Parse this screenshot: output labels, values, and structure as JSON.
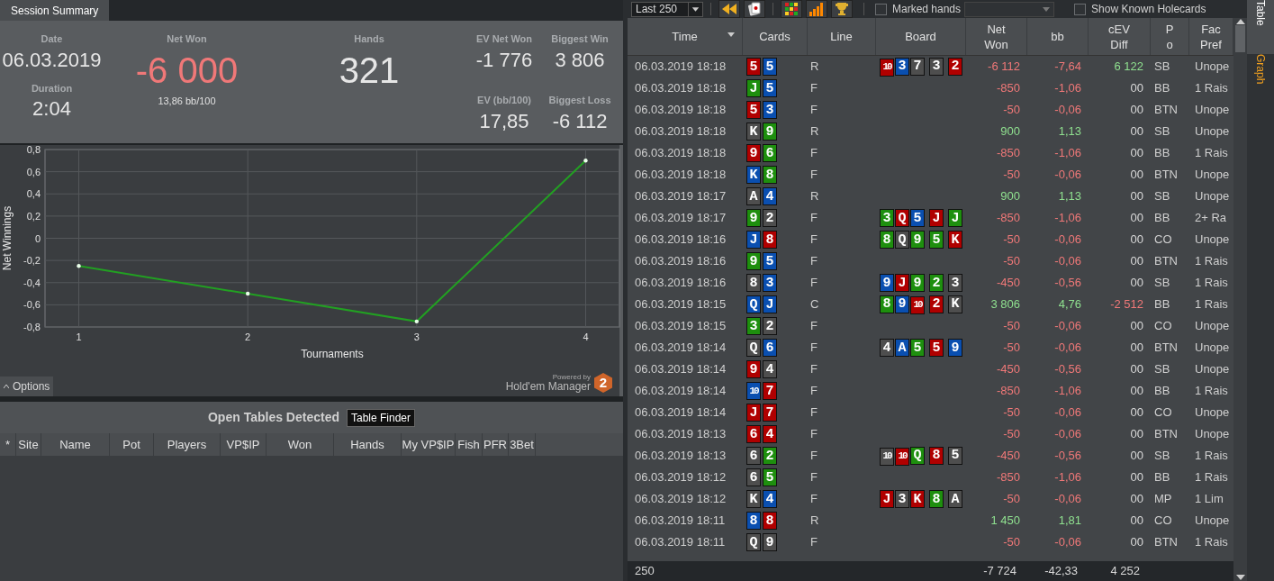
{
  "session_tab": {
    "label": "Session Summary",
    "selected": true
  },
  "summary": {
    "date_label": "Date",
    "date": "06.03.2019",
    "duration_label": "Duration",
    "duration": "2:04",
    "net_won_label": "Net Won",
    "net_won": "-6 000",
    "net_won_negative": true,
    "bb100": "13,86 bb/100",
    "hands_label": "Hands",
    "hands": "321",
    "ev_net_won_label": "EV Net Won",
    "ev_net_won": "-1 776",
    "biggest_win_label": "Biggest Win",
    "biggest_win": "3 806",
    "ev_bb100_label": "EV (bb/100)",
    "ev_bb100": "17,85",
    "biggest_loss_label": "Biggest Loss",
    "biggest_loss": "-6 112"
  },
  "chart": {
    "chart_data": {
      "type": "line",
      "xlabel": "Tournaments",
      "ylabel": "Net Winnings",
      "x": [
        1,
        2,
        3,
        4
      ],
      "grid": true,
      "series": [
        {
          "color": "#22a022",
          "values": [
            -0.25,
            -0.5,
            -0.75,
            0.7
          ]
        }
      ],
      "xlim": [
        0.8,
        4.2
      ],
      "ylim": [
        -0.8,
        0.8
      ],
      "xticks": [
        1,
        2,
        3,
        4
      ],
      "yticks": [
        {
          "value": 0.8,
          "label": "0,8"
        },
        {
          "value": 0.6,
          "label": "0,6"
        },
        {
          "value": 0.4,
          "label": "0,4"
        },
        {
          "value": 0.2,
          "label": "0,2"
        },
        {
          "value": 0,
          "label": "0"
        },
        {
          "value": -0.2,
          "label": "-0,2"
        },
        {
          "value": -0.4,
          "label": "-0,4"
        },
        {
          "value": -0.6,
          "label": "-0,6"
        },
        {
          "value": -0.8,
          "label": "-0,8"
        }
      ]
    },
    "options_label": "Options",
    "powered_by": "Powered by",
    "brand": "Hold'em Manager",
    "brand_badge": "2"
  },
  "open_tables": {
    "title": "Open Tables Detected",
    "finder_button": "Table Finder",
    "columns": [
      "*",
      "Site",
      "Name",
      "Pot",
      "Players",
      "VP$IP",
      "Won",
      "Hands",
      "My VP$IP",
      "Fish",
      "PFR",
      "3Bet"
    ]
  },
  "toolbar": {
    "range": "Last 250",
    "marked_hands": {
      "label": "Marked hands",
      "checked": false
    },
    "show_holecards": {
      "label": "Show Known Holecards",
      "checked": false
    }
  },
  "hands_table": {
    "columns": [
      {
        "lines": [
          "Time"
        ],
        "sortable": true
      },
      {
        "lines": [
          "Cards"
        ],
        "sortable": false
      },
      {
        "lines": [
          "Line"
        ],
        "sortable": false
      },
      {
        "lines": [
          "Board"
        ],
        "sortable": false
      },
      {
        "lines": [
          "Net",
          "Won"
        ],
        "sortable": false
      },
      {
        "lines": [
          "bb"
        ],
        "sortable": false
      },
      {
        "lines": [
          "cEV",
          "Diff"
        ],
        "sortable": false
      },
      {
        "lines": [
          "P",
          "o"
        ],
        "sortable": false
      },
      {
        "lines": [
          "Fac",
          "Pref"
        ],
        "sortable": false
      }
    ],
    "rows": [
      {
        "time": "06.03.2019 18:18",
        "cards": [
          {
            "rank": "5",
            "color": "#b00000"
          },
          {
            "rank": "5",
            "color": "#0a4fb0"
          }
        ],
        "line": "R",
        "board": [
          {
            "rank": "10",
            "color": "#b00000"
          },
          {
            "rank": "3",
            "color": "#0a4fb0"
          },
          {
            "rank": "7",
            "color": "#4e4e4e"
          },
          {
            "rank": "3",
            "color": "#4e4e4e"
          },
          {
            "rank": "2",
            "color": "#b00000"
          }
        ],
        "net_won": "-6 112",
        "bb": "-7,64",
        "cev_diff": "6 122",
        "position": "SB",
        "facing": "Unope",
        "negative": true,
        "cev_gain": true,
        "cev_loss": false
      },
      {
        "time": "06.03.2019 18:18",
        "cards": [
          {
            "rank": "J",
            "color": "#1e8f0e"
          },
          {
            "rank": "5",
            "color": "#0a4fb0"
          }
        ],
        "line": "F",
        "net_won": "-850",
        "bb": "-1,06",
        "cev_diff": "00",
        "position": "BB",
        "facing": "1 Rais",
        "negative": true,
        "cev_gain": false,
        "cev_loss": false
      },
      {
        "time": "06.03.2019 18:18",
        "cards": [
          {
            "rank": "5",
            "color": "#b00000"
          },
          {
            "rank": "3",
            "color": "#0a4fb0"
          }
        ],
        "line": "F",
        "net_won": "-50",
        "bb": "-0,06",
        "cev_diff": "00",
        "position": "BTN",
        "facing": "Unope",
        "negative": true,
        "cev_gain": false,
        "cev_loss": false
      },
      {
        "time": "06.03.2019 18:18",
        "cards": [
          {
            "rank": "K",
            "color": "#4e4e4e"
          },
          {
            "rank": "9",
            "color": "#1e8f0e"
          }
        ],
        "line": "R",
        "net_won": "900",
        "bb": "1,13",
        "cev_diff": "00",
        "position": "SB",
        "facing": "Unope",
        "negative": false,
        "cev_gain": false,
        "cev_loss": false
      },
      {
        "time": "06.03.2019 18:18",
        "cards": [
          {
            "rank": "9",
            "color": "#b00000"
          },
          {
            "rank": "6",
            "color": "#1e8f0e"
          }
        ],
        "line": "F",
        "net_won": "-850",
        "bb": "-1,06",
        "cev_diff": "00",
        "position": "BB",
        "facing": "1 Rais",
        "negative": true,
        "cev_gain": false,
        "cev_loss": false
      },
      {
        "time": "06.03.2019 18:18",
        "cards": [
          {
            "rank": "K",
            "color": "#0a4fb0"
          },
          {
            "rank": "8",
            "color": "#1e8f0e"
          }
        ],
        "line": "F",
        "net_won": "-50",
        "bb": "-0,06",
        "cev_diff": "00",
        "position": "BTN",
        "facing": "Unope",
        "negative": true,
        "cev_gain": false,
        "cev_loss": false
      },
      {
        "time": "06.03.2019 18:17",
        "cards": [
          {
            "rank": "A",
            "color": "#4e4e4e"
          },
          {
            "rank": "4",
            "color": "#0a4fb0"
          }
        ],
        "line": "R",
        "net_won": "900",
        "bb": "1,13",
        "cev_diff": "00",
        "position": "SB",
        "facing": "Unope",
        "negative": false,
        "cev_gain": false,
        "cev_loss": false
      },
      {
        "time": "06.03.2019 18:17",
        "cards": [
          {
            "rank": "9",
            "color": "#1e8f0e"
          },
          {
            "rank": "2",
            "color": "#4e4e4e"
          }
        ],
        "line": "F",
        "board": [
          {
            "rank": "3",
            "color": "#1e8f0e"
          },
          {
            "rank": "Q",
            "color": "#b00000"
          },
          {
            "rank": "5",
            "color": "#0a4fb0"
          },
          {
            "rank": "J",
            "color": "#b00000"
          },
          {
            "rank": "J",
            "color": "#1e8f0e"
          }
        ],
        "net_won": "-850",
        "bb": "-1,06",
        "cev_diff": "00",
        "position": "BB",
        "facing": "2+ Ra",
        "negative": true,
        "cev_gain": false,
        "cev_loss": false
      },
      {
        "time": "06.03.2019 18:16",
        "cards": [
          {
            "rank": "J",
            "color": "#0a4fb0"
          },
          {
            "rank": "8",
            "color": "#b00000"
          }
        ],
        "line": "F",
        "board": [
          {
            "rank": "8",
            "color": "#1e8f0e"
          },
          {
            "rank": "Q",
            "color": "#4e4e4e"
          },
          {
            "rank": "9",
            "color": "#1e8f0e"
          },
          {
            "rank": "5",
            "color": "#1e8f0e"
          },
          {
            "rank": "K",
            "color": "#b00000"
          }
        ],
        "net_won": "-50",
        "bb": "-0,06",
        "cev_diff": "00",
        "position": "CO",
        "facing": "Unope",
        "negative": true,
        "cev_gain": false,
        "cev_loss": false
      },
      {
        "time": "06.03.2019 18:16",
        "cards": [
          {
            "rank": "9",
            "color": "#1e8f0e"
          },
          {
            "rank": "5",
            "color": "#0a4fb0"
          }
        ],
        "line": "F",
        "net_won": "-50",
        "bb": "-0,06",
        "cev_diff": "00",
        "position": "BTN",
        "facing": "1 Rais",
        "negative": true,
        "cev_gain": false,
        "cev_loss": false
      },
      {
        "time": "06.03.2019 18:16",
        "cards": [
          {
            "rank": "8",
            "color": "#4e4e4e"
          },
          {
            "rank": "3",
            "color": "#0a4fb0"
          }
        ],
        "line": "F",
        "board": [
          {
            "rank": "9",
            "color": "#0a4fb0"
          },
          {
            "rank": "J",
            "color": "#b00000"
          },
          {
            "rank": "9",
            "color": "#1e8f0e"
          },
          {
            "rank": "2",
            "color": "#1e8f0e"
          },
          {
            "rank": "3",
            "color": "#4e4e4e"
          }
        ],
        "net_won": "-450",
        "bb": "-0,56",
        "cev_diff": "00",
        "position": "SB",
        "facing": "1 Rais",
        "negative": true,
        "cev_gain": false,
        "cev_loss": false
      },
      {
        "time": "06.03.2019 18:15",
        "cards": [
          {
            "rank": "Q",
            "color": "#0a4fb0"
          },
          {
            "rank": "J",
            "color": "#0a4fb0"
          }
        ],
        "line": "C",
        "board": [
          {
            "rank": "8",
            "color": "#1e8f0e"
          },
          {
            "rank": "9",
            "color": "#0a4fb0"
          },
          {
            "rank": "10",
            "color": "#b00000"
          },
          {
            "rank": "2",
            "color": "#b00000"
          },
          {
            "rank": "K",
            "color": "#4e4e4e"
          }
        ],
        "net_won": "3 806",
        "bb": "4,76",
        "cev_diff": "-2 512",
        "position": "BB",
        "facing": "1 Rais",
        "negative": false,
        "cev_gain": false,
        "cev_loss": true
      },
      {
        "time": "06.03.2019 18:15",
        "cards": [
          {
            "rank": "3",
            "color": "#1e8f0e"
          },
          {
            "rank": "2",
            "color": "#4e4e4e"
          }
        ],
        "line": "F",
        "net_won": "-50",
        "bb": "-0,06",
        "cev_diff": "00",
        "position": "CO",
        "facing": "Unope",
        "negative": true,
        "cev_gain": false,
        "cev_loss": false
      },
      {
        "time": "06.03.2019 18:14",
        "cards": [
          {
            "rank": "Q",
            "color": "#4e4e4e"
          },
          {
            "rank": "6",
            "color": "#0a4fb0"
          }
        ],
        "line": "F",
        "board": [
          {
            "rank": "4",
            "color": "#4e4e4e"
          },
          {
            "rank": "A",
            "color": "#0a4fb0"
          },
          {
            "rank": "5",
            "color": "#1e8f0e"
          },
          {
            "rank": "5",
            "color": "#b00000"
          },
          {
            "rank": "9",
            "color": "#0a4fb0"
          }
        ],
        "net_won": "-50",
        "bb": "-0,06",
        "cev_diff": "00",
        "position": "BTN",
        "facing": "Unope",
        "negative": true,
        "cev_gain": false,
        "cev_loss": false
      },
      {
        "time": "06.03.2019 18:14",
        "cards": [
          {
            "rank": "9",
            "color": "#b00000"
          },
          {
            "rank": "4",
            "color": "#4e4e4e"
          }
        ],
        "line": "F",
        "net_won": "-450",
        "bb": "-0,56",
        "cev_diff": "00",
        "position": "SB",
        "facing": "Unope",
        "negative": true,
        "cev_gain": false,
        "cev_loss": false
      },
      {
        "time": "06.03.2019 18:14",
        "cards": [
          {
            "rank": "10",
            "color": "#0a4fb0"
          },
          {
            "rank": "7",
            "color": "#b00000"
          }
        ],
        "line": "F",
        "net_won": "-850",
        "bb": "-1,06",
        "cev_diff": "00",
        "position": "BB",
        "facing": "1 Rais",
        "negative": true,
        "cev_gain": false,
        "cev_loss": false
      },
      {
        "time": "06.03.2019 18:14",
        "cards": [
          {
            "rank": "J",
            "color": "#b00000"
          },
          {
            "rank": "7",
            "color": "#b00000"
          }
        ],
        "line": "F",
        "net_won": "-50",
        "bb": "-0,06",
        "cev_diff": "00",
        "position": "CO",
        "facing": "Unope",
        "negative": true,
        "cev_gain": false,
        "cev_loss": false
      },
      {
        "time": "06.03.2019 18:13",
        "cards": [
          {
            "rank": "6",
            "color": "#b00000"
          },
          {
            "rank": "4",
            "color": "#b00000"
          }
        ],
        "line": "F",
        "net_won": "-50",
        "bb": "-0,06",
        "cev_diff": "00",
        "position": "BTN",
        "facing": "Unope",
        "negative": true,
        "cev_gain": false,
        "cev_loss": false
      },
      {
        "time": "06.03.2019 18:13",
        "cards": [
          {
            "rank": "6",
            "color": "#4e4e4e"
          },
          {
            "rank": "2",
            "color": "#1e8f0e"
          }
        ],
        "line": "F",
        "board": [
          {
            "rank": "10",
            "color": "#4e4e4e"
          },
          {
            "rank": "10",
            "color": "#b00000"
          },
          {
            "rank": "Q",
            "color": "#1e8f0e"
          },
          {
            "rank": "8",
            "color": "#b00000"
          },
          {
            "rank": "5",
            "color": "#4e4e4e"
          }
        ],
        "net_won": "-450",
        "bb": "-0,56",
        "cev_diff": "00",
        "position": "SB",
        "facing": "1 Rais",
        "negative": true,
        "cev_gain": false,
        "cev_loss": false
      },
      {
        "time": "06.03.2019 18:12",
        "cards": [
          {
            "rank": "6",
            "color": "#4e4e4e"
          },
          {
            "rank": "5",
            "color": "#1e8f0e"
          }
        ],
        "line": "F",
        "net_won": "-850",
        "bb": "-1,06",
        "cev_diff": "00",
        "position": "BB",
        "facing": "1 Rais",
        "negative": true,
        "cev_gain": false,
        "cev_loss": false
      },
      {
        "time": "06.03.2019 18:12",
        "cards": [
          {
            "rank": "K",
            "color": "#4e4e4e"
          },
          {
            "rank": "4",
            "color": "#0a4fb0"
          }
        ],
        "line": "F",
        "board": [
          {
            "rank": "J",
            "color": "#b00000"
          },
          {
            "rank": "3",
            "color": "#4e4e4e"
          },
          {
            "rank": "K",
            "color": "#b00000"
          },
          {
            "rank": "8",
            "color": "#1e8f0e"
          },
          {
            "rank": "A",
            "color": "#4e4e4e"
          }
        ],
        "net_won": "-50",
        "bb": "-0,06",
        "cev_diff": "00",
        "position": "MP",
        "facing": "1 Lim",
        "negative": true,
        "cev_gain": false,
        "cev_loss": false
      },
      {
        "time": "06.03.2019 18:11",
        "cards": [
          {
            "rank": "8",
            "color": "#0a4fb0"
          },
          {
            "rank": "8",
            "color": "#b00000"
          }
        ],
        "line": "R",
        "net_won": "1 450",
        "bb": "1,81",
        "cev_diff": "00",
        "position": "CO",
        "facing": "Unope",
        "negative": false,
        "cev_gain": false,
        "cev_loss": false
      },
      {
        "time": "06.03.2019 18:11",
        "cards": [
          {
            "rank": "Q",
            "color": "#4e4e4e"
          },
          {
            "rank": "9",
            "color": "#4e4e4e"
          }
        ],
        "line": "F",
        "net_won": "-50",
        "bb": "-0,06",
        "cev_diff": "00",
        "position": "BTN",
        "facing": "1 Rais",
        "negative": true,
        "cev_gain": false,
        "cev_loss": false
      }
    ],
    "footer": {
      "count": "250",
      "net_won": "-7 724",
      "bb": "-42,33",
      "cev_diff": "4 252"
    }
  },
  "side_tabs": [
    {
      "label": "Table",
      "selected": true
    },
    {
      "label": "Graph",
      "selected": false
    }
  ]
}
